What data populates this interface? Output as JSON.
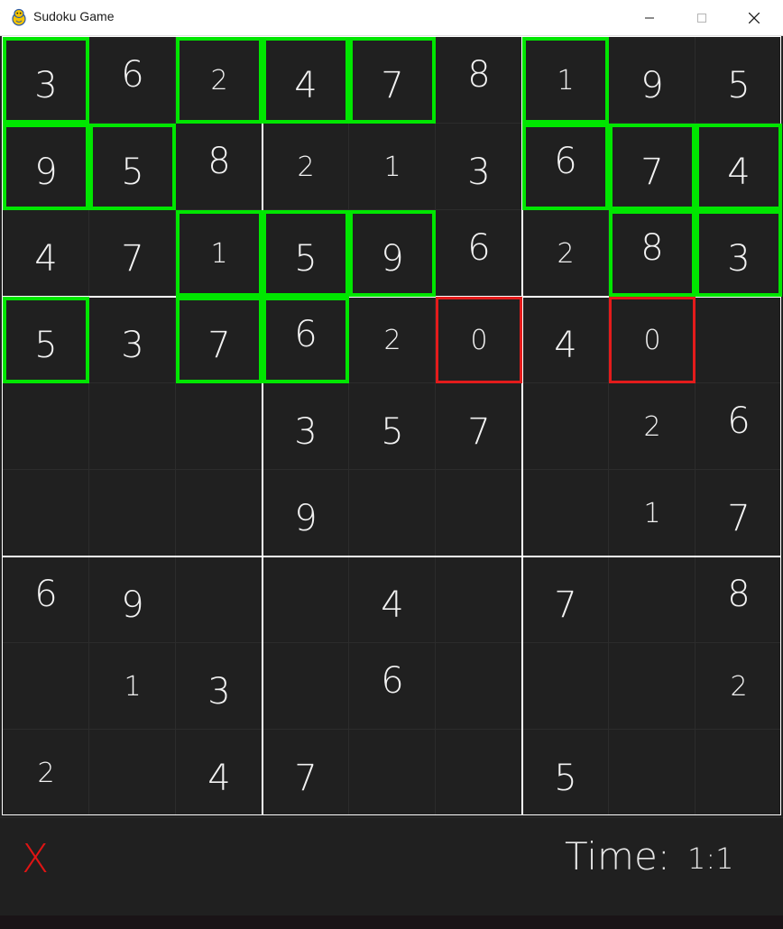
{
  "window": {
    "title": "Sudoku Game",
    "app_icon": "pygame-snake-icon",
    "controls": [
      "minimize-icon",
      "maximize-icon",
      "close-icon"
    ]
  },
  "colors": {
    "background": "#202020",
    "digit": "#f2f2f2",
    "correct_highlight": "#00e600",
    "wrong_highlight": "#e31b1b",
    "strike": "#e01414",
    "box_border": "#ffffff"
  },
  "board": {
    "rows": [
      [
        "3",
        "6",
        "2",
        "4",
        "7",
        "8",
        "1",
        "9",
        "5"
      ],
      [
        "9",
        "5",
        "8",
        "2",
        "1",
        "3",
        "6",
        "7",
        "4"
      ],
      [
        "4",
        "7",
        "1",
        "5",
        "9",
        "6",
        "2",
        "8",
        "3"
      ],
      [
        "5",
        "3",
        "7",
        "6",
        "2",
        "0",
        "4",
        "0",
        ""
      ],
      [
        "",
        "",
        "",
        "3",
        "5",
        "7",
        "",
        "2",
        "6"
      ],
      [
        "",
        "",
        "",
        "9",
        "",
        "",
        "",
        "1",
        "7"
      ],
      [
        "6",
        "9",
        "",
        "",
        "4",
        "",
        "7",
        "",
        "8"
      ],
      [
        "",
        "1",
        "3",
        "",
        "6",
        "",
        "",
        "",
        "2"
      ],
      [
        "2",
        "",
        "4",
        "7",
        "",
        "",
        "5",
        "",
        ""
      ]
    ],
    "correct_cells": [
      [
        0,
        0
      ],
      [
        0,
        2
      ],
      [
        0,
        3
      ],
      [
        0,
        4
      ],
      [
        0,
        6
      ],
      [
        1,
        0
      ],
      [
        1,
        1
      ],
      [
        1,
        6
      ],
      [
        1,
        7
      ],
      [
        1,
        8
      ],
      [
        2,
        2
      ],
      [
        2,
        3
      ],
      [
        2,
        4
      ],
      [
        2,
        7
      ],
      [
        2,
        8
      ],
      [
        3,
        0
      ],
      [
        3,
        2
      ],
      [
        3,
        3
      ]
    ],
    "wrong_cells": [
      [
        3,
        5
      ],
      [
        3,
        7
      ]
    ]
  },
  "status": {
    "strikes": "X",
    "time_label": "Time:",
    "time_value": "1:1"
  }
}
